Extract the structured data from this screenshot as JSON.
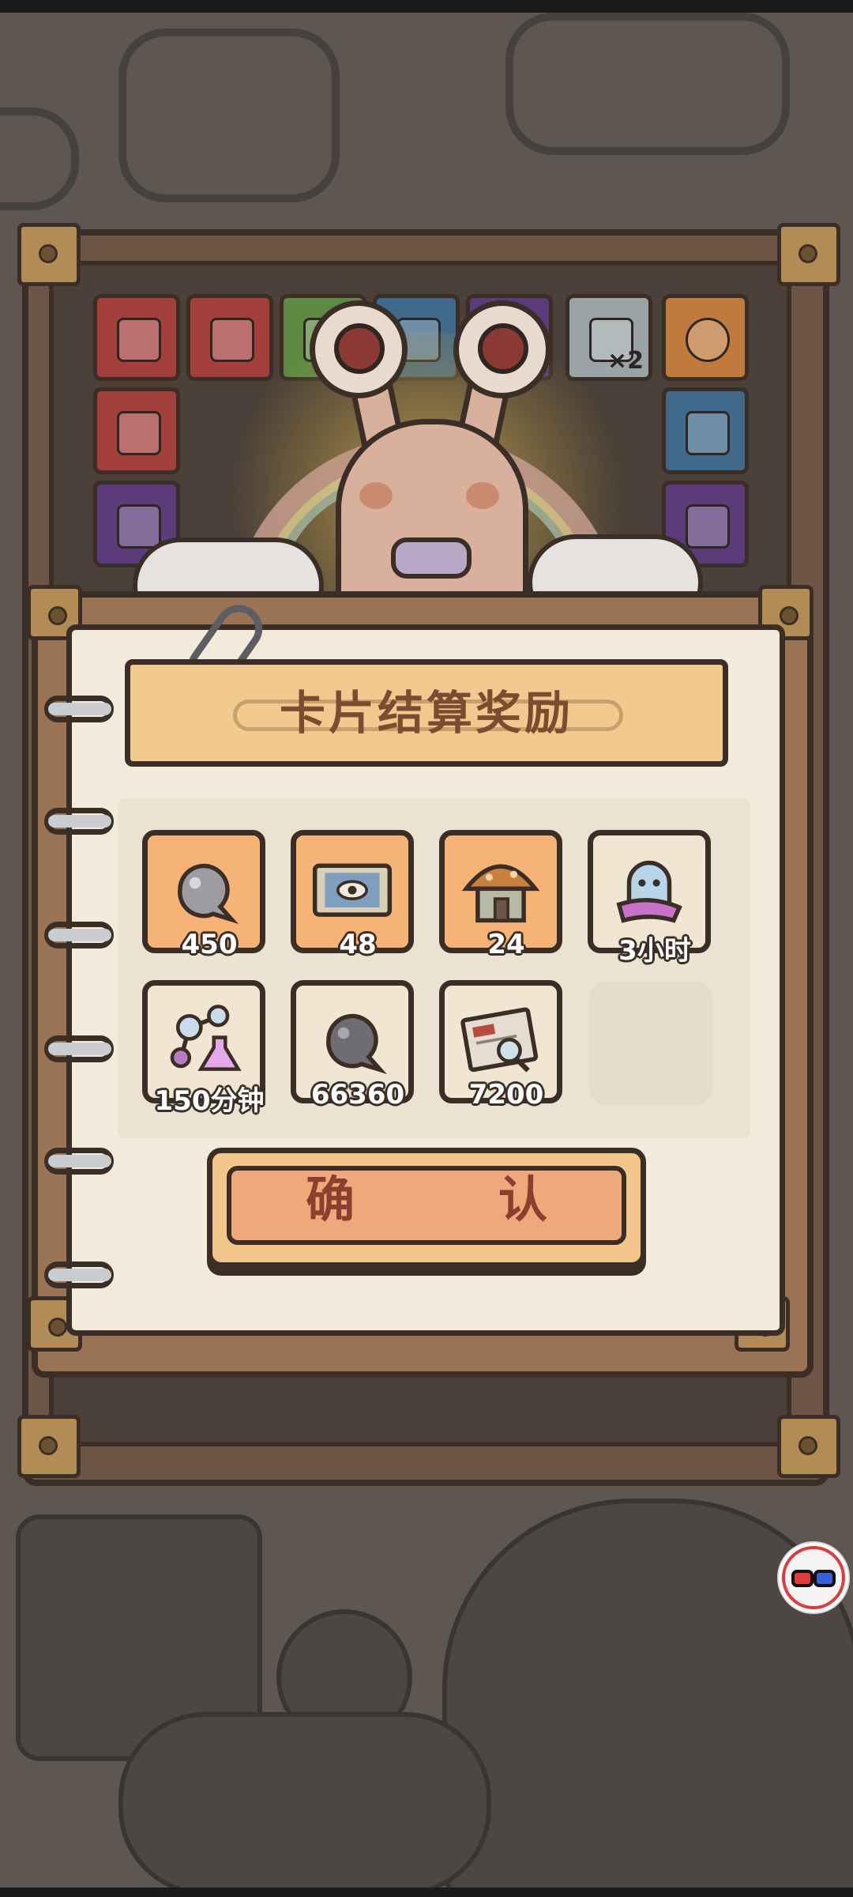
{
  "dialog": {
    "title": "卡片结算奖励",
    "confirm_label": "确　认"
  },
  "rewards": [
    {
      "icon": "ghost-blob-icon",
      "count": "450",
      "bg": "orange"
    },
    {
      "icon": "map-scroll-icon",
      "count": "48",
      "bg": "orange"
    },
    {
      "icon": "mushroom-house-icon",
      "count": "24",
      "bg": "orange"
    },
    {
      "icon": "ghost-cloak-icon",
      "count": "3小时",
      "bg": "cream"
    },
    {
      "icon": "flask-molecule-icon",
      "count": "150分钟",
      "bg": "cream"
    },
    {
      "icon": "dark-blob-icon",
      "count": "66360",
      "bg": "cream"
    },
    {
      "icon": "newspaper-magnifier-icon",
      "count": "7200",
      "bg": "cream"
    }
  ],
  "background": {
    "mascot": "snail-icon",
    "card_badge": "×2"
  },
  "colors": {
    "banner": "#f2c98f",
    "confirm": "#f0a87b",
    "outline": "#3a2e27",
    "reward_orange": "#f5b476",
    "reward_cream": "#f1e6d2"
  }
}
